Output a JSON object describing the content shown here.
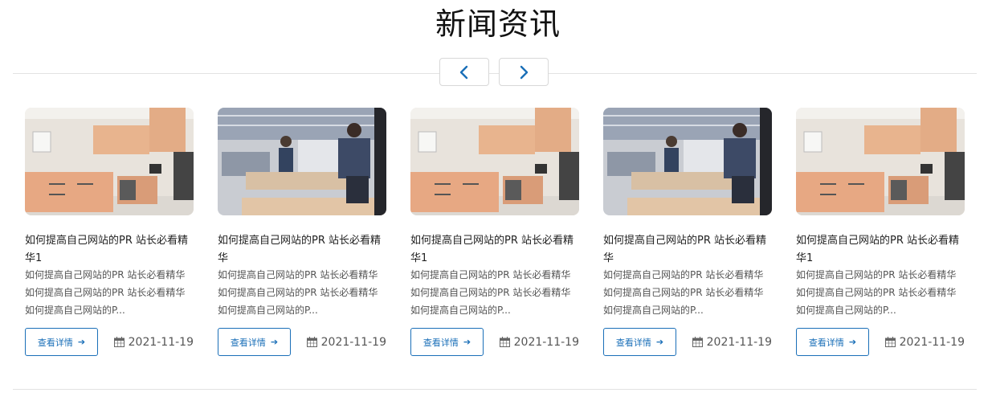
{
  "section": {
    "title": "新闻资讯"
  },
  "nav": {
    "prev_icon": "chevron-left-icon",
    "next_icon": "chevron-right-icon",
    "accent": "#1a6fb8"
  },
  "cards": [
    {
      "image": "kitchen",
      "title": "如何提高自己网站的PR 站长必看精华1",
      "desc": "如何提高自己网站的PR 站长必看精华如何提高自己网站的PR 站长必看精华如何提高自己网站的P...",
      "button": "查看详情",
      "date": "2021-11-19"
    },
    {
      "image": "factory",
      "title": "如何提高自己网站的PR 站长必看精华",
      "desc": "如何提高自己网站的PR 站长必看精华如何提高自己网站的PR 站长必看精华如何提高自己网站的P...",
      "button": "查看详情",
      "date": "2021-11-19"
    },
    {
      "image": "kitchen",
      "title": "如何提高自己网站的PR 站长必看精华1",
      "desc": "如何提高自己网站的PR 站长必看精华如何提高自己网站的PR 站长必看精华如何提高自己网站的P...",
      "button": "查看详情",
      "date": "2021-11-19"
    },
    {
      "image": "factory",
      "title": "如何提高自己网站的PR 站长必看精华",
      "desc": "如何提高自己网站的PR 站长必看精华如何提高自己网站的PR 站长必看精华如何提高自己网站的P...",
      "button": "查看详情",
      "date": "2021-11-19"
    },
    {
      "image": "kitchen",
      "title": "如何提高自己网站的PR 站长必看精华1",
      "desc": "如何提高自己网站的PR 站长必看精华如何提高自己网站的PR 站长必看精华如何提高自己网站的P...",
      "button": "查看详情",
      "date": "2021-11-19"
    }
  ]
}
